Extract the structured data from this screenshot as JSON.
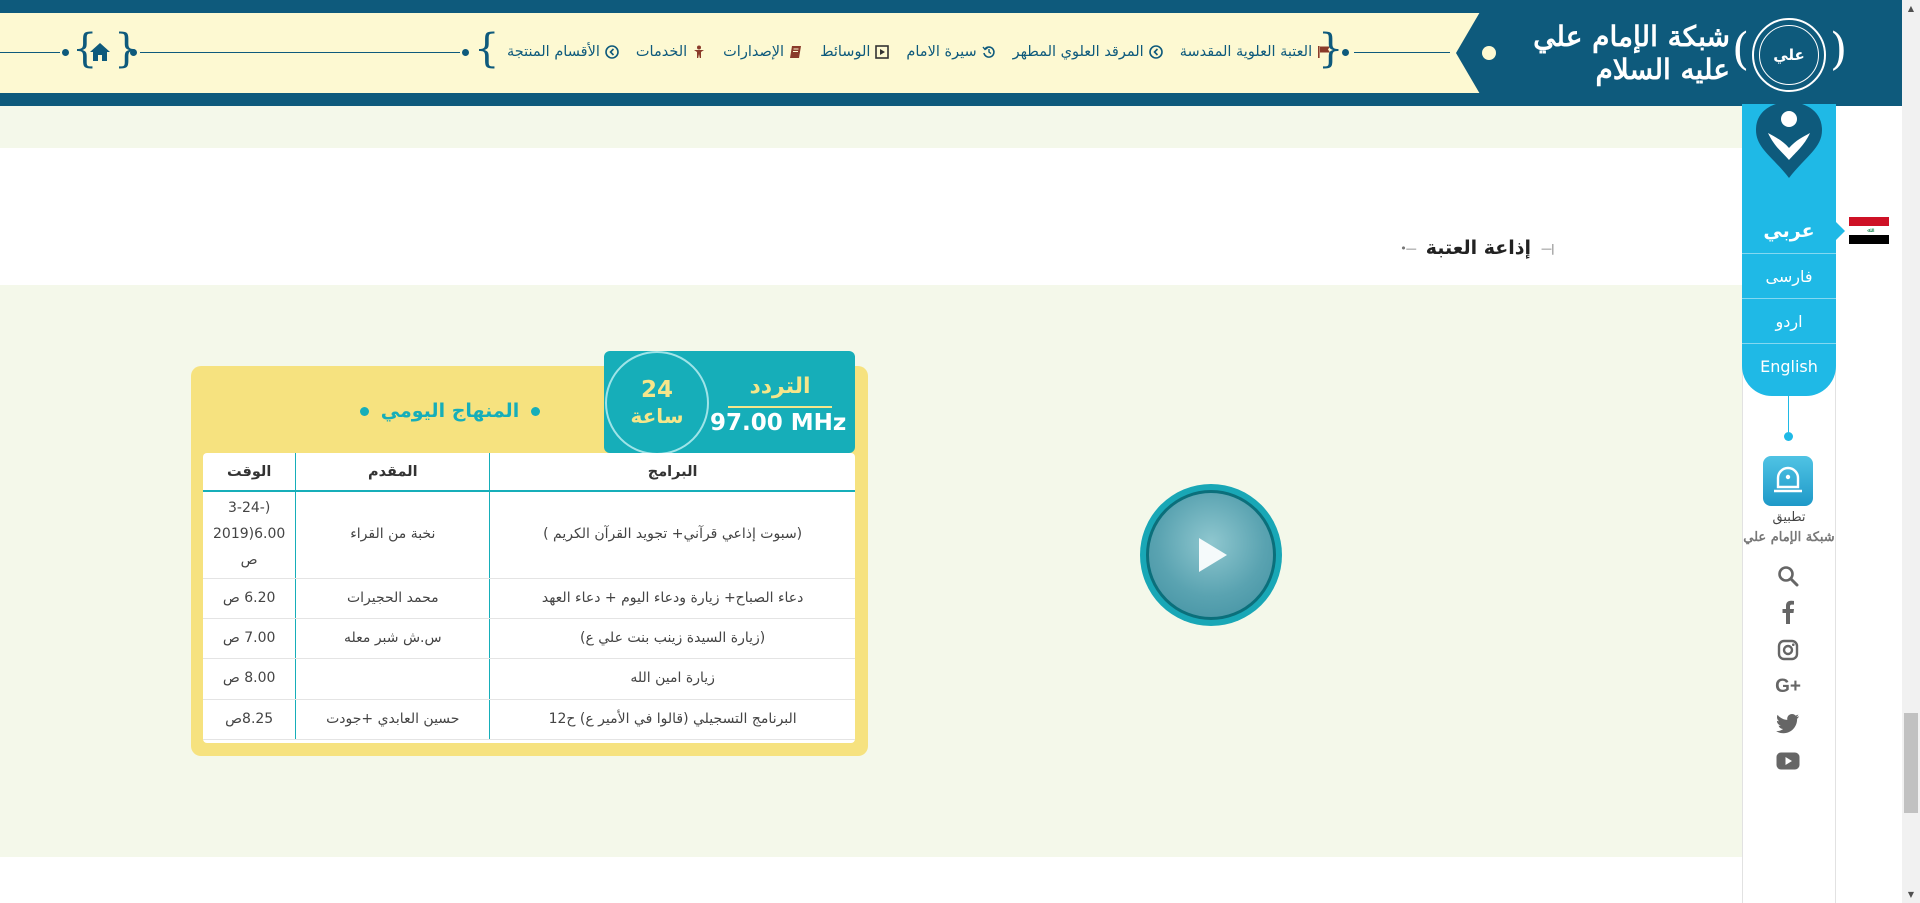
{
  "nav": {
    "items": [
      {
        "label": "العتبة العلوية المقدسة",
        "icon": "flag-icon"
      },
      {
        "label": "المرقد العلوي المطهر",
        "icon": "circle-arrow-icon"
      },
      {
        "label": "سيرة الامام",
        "icon": "history-icon"
      },
      {
        "label": "الوسائط",
        "icon": "media-icon"
      },
      {
        "label": "الإصدارات",
        "icon": "book-icon"
      },
      {
        "label": "الخدمات",
        "icon": "person-icon"
      },
      {
        "label": "الأقسام المنتجة",
        "icon": "circle-arrow-icon"
      }
    ]
  },
  "logo": {
    "text": "شبكة الإمام علي عليه السلام",
    "emblem_text": "علي"
  },
  "section": {
    "title": "إذاعة العتبة"
  },
  "radio": {
    "frequency_label": "التردد",
    "frequency_value": "97.00 MHz",
    "hours_number": "24",
    "hours_unit": "ساعة",
    "schedule_title": "المنهاج اليومي",
    "table": {
      "headers": {
        "program": "البرامج",
        "host": "المقدم",
        "time": "الوقت"
      },
      "rows": [
        {
          "program": "(سبوت إذاعي قرآني+ تجويد القرآن الكريم )",
          "host": "نخبة من القراء",
          "time": "(-3-24 6.00(2019 ص"
        },
        {
          "program": "دعاء الصباح+ زيارة ودعاء اليوم + دعاء العهد",
          "host": "محمد الحجيرات",
          "time": "6.20 ص"
        },
        {
          "program": "(زيارة السيدة زينب بنت علي ع)",
          "host": "س.ش شبر معله",
          "time": "7.00 ص"
        },
        {
          "program": "زيارة امين الله",
          "host": "",
          "time": "8.00 ص"
        },
        {
          "program": "البرنامج التسجيلي (قالوا في الأمير ع) ح12",
          "host": "حسين العابدي +جودت",
          "time": "8.25ص"
        }
      ]
    }
  },
  "languages": [
    {
      "label": "عربي",
      "active": true
    },
    {
      "label": "فارسی",
      "active": false
    },
    {
      "label": "اردو",
      "active": false
    },
    {
      "label": "English",
      "active": false
    }
  ],
  "app": {
    "label": "تطبيق",
    "sub": "شبكة الإمام علي"
  },
  "social": [
    "search-icon",
    "facebook-icon",
    "instagram-icon",
    "google-plus-icon",
    "twitter-icon",
    "youtube-icon"
  ],
  "colors": {
    "navy": "#0e5a7c",
    "cream": "#fdf9d2",
    "teal": "#16aeb9",
    "yellow": "#f6e27f",
    "sky": "#1fb9e6"
  }
}
